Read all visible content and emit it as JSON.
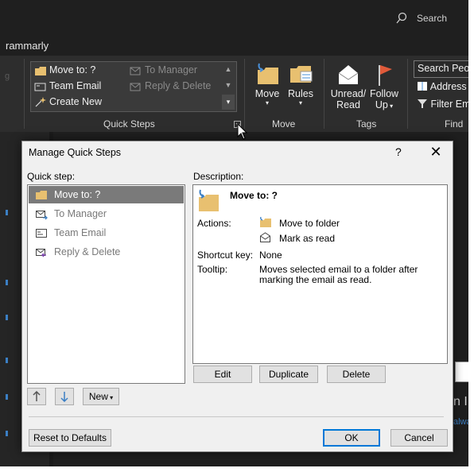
{
  "app": {
    "search_label": "Search",
    "tab_partial": "rammarly"
  },
  "ribbon": {
    "quick_steps": {
      "items_left": [
        "Move to: ?",
        "Team Email",
        "Create New"
      ],
      "items_right": [
        "To Manager",
        "Reply & Delete"
      ],
      "group_label": "Quick Steps"
    },
    "move_group": {
      "move_label": "Move",
      "rules_label": "Rules",
      "group_label": "Move"
    },
    "tags_group": {
      "unread_label_1": "Unread/",
      "unread_label_2": "Read",
      "follow_label_1": "Follow",
      "follow_label_2": "Up",
      "group_label": "Tags"
    },
    "find_group": {
      "search_people": "Search Peop",
      "address_book": "Address",
      "filter_email": "Filter Em",
      "group_label": "Find"
    }
  },
  "dialog": {
    "title": "Manage Quick Steps",
    "help": "?",
    "close": "✕",
    "quick_step_label": "Quick step:",
    "description_label": "Description:",
    "list": [
      {
        "label": "Move to: ?",
        "selected": true
      },
      {
        "label": "To Manager",
        "selected": false
      },
      {
        "label": "Team Email",
        "selected": false
      },
      {
        "label": "Reply & Delete",
        "selected": false
      }
    ],
    "description": {
      "name": "Move to: ?",
      "actions_label": "Actions:",
      "actions": [
        "Move to folder",
        "Mark as read"
      ],
      "shortcut_label": "Shortcut key:",
      "shortcut_value": "None",
      "tooltip_label": "Tooltip:",
      "tooltip_line1": "Moves selected email to a folder after",
      "tooltip_line2": "marking the email as read."
    },
    "buttons": {
      "edit": "Edit",
      "duplicate": "Duplicate",
      "delete": "Delete",
      "new": "New",
      "reset": "Reset to Defaults",
      "ok": "OK",
      "cancel": "Cancel"
    },
    "colors": {
      "accent": "#0078d7",
      "selection": "#7a7a7a",
      "folder": "#e8c070"
    }
  },
  "background_text": {
    "fragment_1": "n I",
    "fragment_2": "alwa"
  }
}
